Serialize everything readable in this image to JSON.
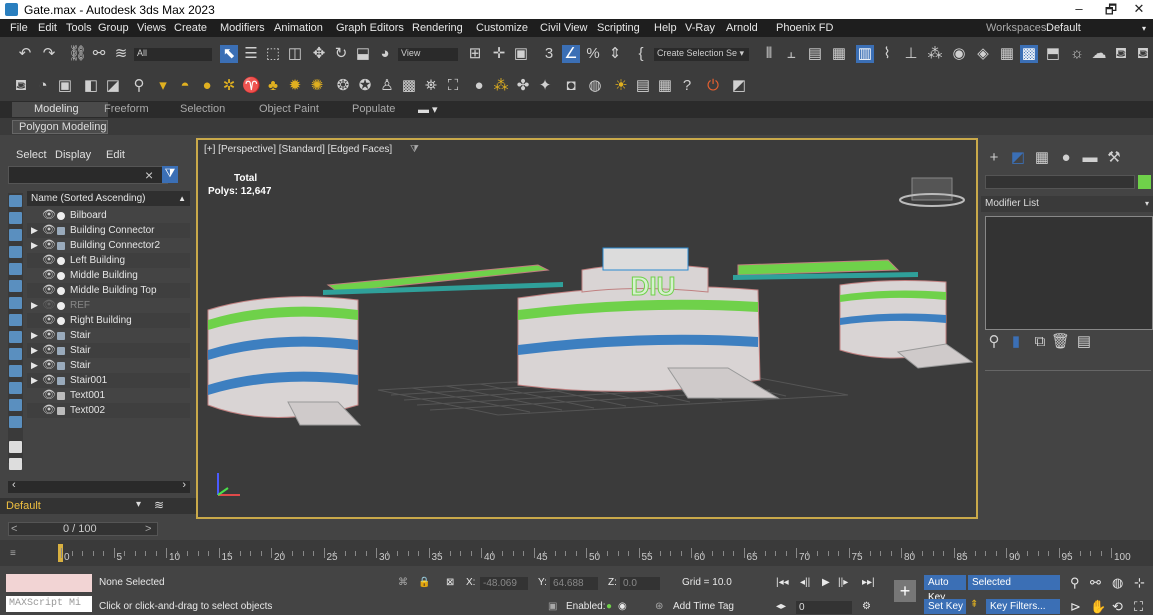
{
  "window": {
    "title": "Gate.max - Autodesk 3ds Max 2023",
    "min": "–",
    "max": "🗗",
    "close": "✕"
  },
  "menu": [
    "File",
    "Edit",
    "Tools",
    "Group",
    "Views",
    "Create",
    "Modifiers",
    "Animation",
    "Graph Editors",
    "Rendering",
    "Customize",
    "Civil View",
    "Scripting",
    "Help",
    "V-Ray",
    "Arnold",
    "Phoenix FD"
  ],
  "workspace": {
    "label": "Workspaces:",
    "value": "Default"
  },
  "toolbar": {
    "filter": "All",
    "refcoord": "View",
    "selset": "Create Selection Se"
  },
  "ribbon": {
    "tabs": [
      "Modeling",
      "Freeform",
      "Selection",
      "Object Paint",
      "Populate"
    ],
    "sub": "Polygon Modeling"
  },
  "scene_explorer": {
    "tabs": [
      "Select",
      "Display",
      "Edit"
    ],
    "column_header": "Name (Sorted Ascending)",
    "rows": [
      {
        "name": "Bilboard",
        "kind": "dot"
      },
      {
        "name": "Building Connector",
        "kind": "group"
      },
      {
        "name": "Building Connector2",
        "kind": "group"
      },
      {
        "name": "Left Building",
        "kind": "dot"
      },
      {
        "name": "Middle Building",
        "kind": "dot"
      },
      {
        "name": "Middle Building Top",
        "kind": "dot"
      },
      {
        "name": "REF",
        "kind": "hidden"
      },
      {
        "name": "Right Building",
        "kind": "dot"
      },
      {
        "name": "Stair",
        "kind": "group"
      },
      {
        "name": "Stair",
        "kind": "group"
      },
      {
        "name": "Stair",
        "kind": "group"
      },
      {
        "name": "Stair001",
        "kind": "group"
      },
      {
        "name": "Text001",
        "kind": "text"
      },
      {
        "name": "Text002",
        "kind": "text"
      }
    ],
    "layer": "Default"
  },
  "viewport": {
    "label": "[+] [Perspective] [Standard] [Edged Faces]",
    "stats_title": "Total",
    "stats_polys": "Polys: 12,647",
    "logo_text": "DIU"
  },
  "command_panel": {
    "modifier_list": "Modifier List"
  },
  "timeslider": {
    "frame": "0 / 100"
  },
  "trackbar": {
    "ticks": [
      "0",
      "5",
      "10",
      "15",
      "20",
      "25",
      "30",
      "35",
      "40",
      "45",
      "50",
      "55",
      "60",
      "65",
      "70",
      "75",
      "80",
      "85",
      "90",
      "95",
      "100"
    ]
  },
  "status": {
    "maxscript": "MAXScript Mi",
    "selection": "None Selected",
    "prompt": "Click or click-and-drag to select objects",
    "x_label": "X:",
    "x": "-48.069",
    "y_label": "Y:",
    "y": "64.688",
    "z_label": "Z:",
    "z": "0.0",
    "grid": "Grid = 10.0",
    "enabled": "Enabled:",
    "addtimetag": "Add Time Tag",
    "autokey": "Auto Key",
    "selected": "Selected",
    "setkey": "Set Key",
    "keyfilters": "Key Filters...",
    "frame_field": "0"
  },
  "colors": {
    "accent_blue": "#3b6fb5",
    "viewport_border": "#c9a94a",
    "green": "#6fd14a",
    "layer_yellow": "#f0c040"
  }
}
